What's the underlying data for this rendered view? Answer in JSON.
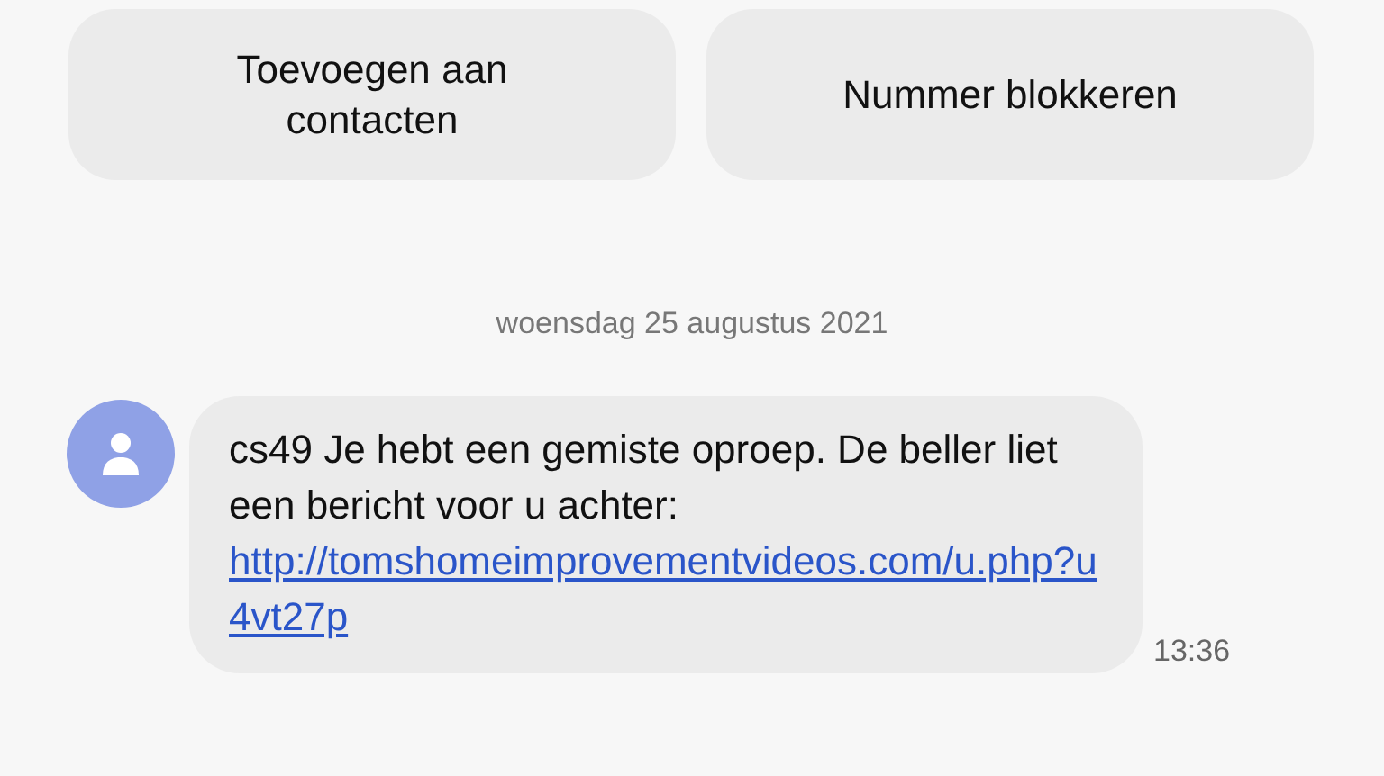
{
  "actions": [
    {
      "label": "Toevoegen aan contacten"
    },
    {
      "label": "Nummer blokkeren"
    }
  ],
  "date_divider": "woensdag 25 augustus 2021",
  "messages": [
    {
      "text": "cs49 Je hebt een gemiste oproep. De beller liet een bericht voor u achter:",
      "link": "http://tomshomeimprovementvideos.com/u.php?u4vt27p",
      "time": "13:36"
    }
  ]
}
